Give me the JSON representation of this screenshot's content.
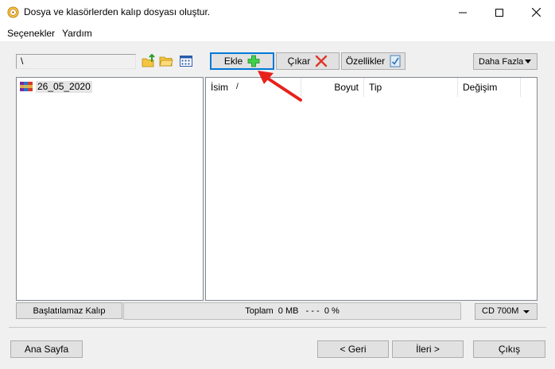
{
  "window": {
    "title": "Dosya ve klasörlerden kalıp dosyası oluştur."
  },
  "menu": {
    "items": [
      "Seçenekler",
      "Yardım"
    ]
  },
  "path": {
    "value": "\\"
  },
  "toolbar": {
    "add_label": "Ekle",
    "remove_label": "Çıkar",
    "properties_label": "Özellikler",
    "more_label": "Daha Fazla"
  },
  "tree": {
    "items": [
      {
        "label": "26_05_2020"
      }
    ]
  },
  "list": {
    "columns": [
      "İsim",
      "Boyut",
      "Tip",
      "Değişim"
    ],
    "sort_indicator": "/"
  },
  "status": {
    "boot_label": "Başlatılamaz Kalıp",
    "total_text": "Toplam  0 MB   - - -  0 %",
    "media_selected": "CD 700M"
  },
  "footer": {
    "home_label": "Ana Sayfa",
    "back_label": "< Geri",
    "next_label": "İleri >",
    "exit_label": "Çıkış"
  },
  "colors": {
    "accent": "#0078d7",
    "add_icon": "#2ecc40",
    "remove_icon": "#e0352b",
    "annotation_arrow": "#e8211b"
  }
}
